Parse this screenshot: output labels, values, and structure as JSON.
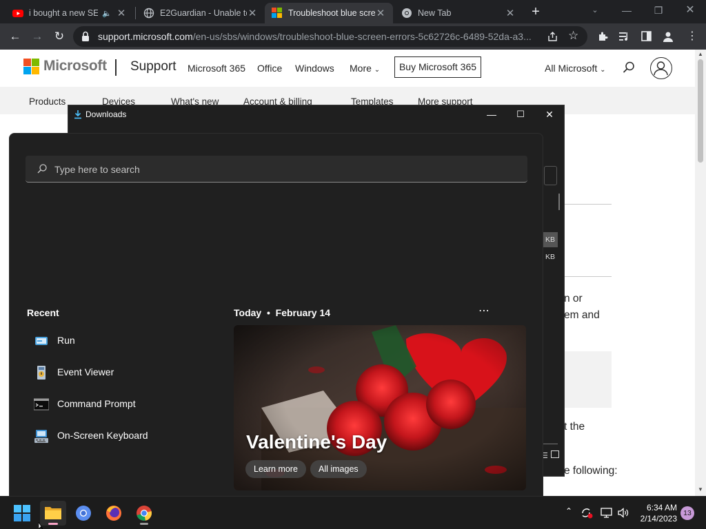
{
  "browser": {
    "tabs": [
      {
        "title": "i bought a new SEM",
        "favicon": "youtube-icon"
      },
      {
        "title": "E2Guardian - Unable to",
        "favicon": "globe-icon"
      },
      {
        "title": "Troubleshoot blue scre",
        "favicon": "microsoft-icon"
      },
      {
        "title": "New Tab",
        "favicon": "chrome-icon"
      }
    ],
    "url_host": "support.microsoft.com",
    "url_path": "/en-us/sbs/windows/troubleshoot-blue-screen-errors-5c62726c-6489-52da-a3..."
  },
  "ms_page": {
    "brand": "Microsoft",
    "section": "Support",
    "nav": [
      "Microsoft 365",
      "Office",
      "Windows",
      "More"
    ],
    "buy_label": "Buy Microsoft 365",
    "all_ms": "All Microsoft",
    "subnav": [
      "Products",
      "Devices",
      "What's new",
      "Account & billing",
      "Templates",
      "More support"
    ],
    "article_fragments": [
      "n or",
      "em and",
      "t the",
      "e following:"
    ]
  },
  "downloads": {
    "title": "Downloads",
    "size_labels": [
      "KB",
      "KB"
    ]
  },
  "start_menu": {
    "search_placeholder": "Type here to search",
    "recent_heading": "Recent",
    "recent_items": [
      {
        "label": "Run",
        "icon": "run-icon"
      },
      {
        "label": "Event Viewer",
        "icon": "event-viewer-icon"
      },
      {
        "label": "Command Prompt",
        "icon": "command-prompt-icon"
      },
      {
        "label": "On-Screen Keyboard",
        "icon": "on-screen-keyboard-icon"
      }
    ],
    "today_label": "Today",
    "date_label": "February 14",
    "card_title": "Valentine's Day",
    "learn_more": "Learn more",
    "all_images": "All images"
  },
  "taskbar": {
    "apps": [
      "start-icon",
      "file-explorer-icon",
      "chromium-icon",
      "firefox-icon",
      "chrome-icon"
    ],
    "time": "6:34 AM",
    "date": "2/14/2023",
    "notifications": "13"
  },
  "colors": {
    "ms_red": "#f25022",
    "ms_green": "#7fba00",
    "ms_blue": "#00a4ef",
    "ms_yellow": "#ffb900",
    "start_bg": "#202020",
    "taskbar_bg": "#1c1c1c",
    "chrome_dark": "#202124"
  }
}
